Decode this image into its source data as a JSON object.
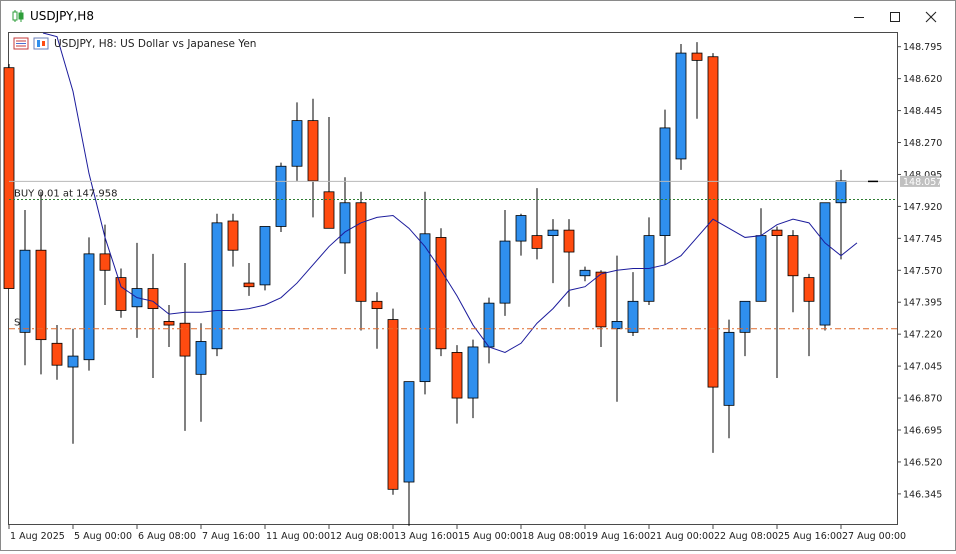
{
  "window": {
    "title": "USDJPY,H8"
  },
  "chart_header": {
    "text": "USDJPY, H8:  US Dollar vs Japanese Yen"
  },
  "trade_line": {
    "label": "BUY 0.01 at 147.958",
    "price": 147.958,
    "color": "#2e7d32"
  },
  "stop_line": {
    "label": "S",
    "price": 147.25,
    "color": "#e06a2c"
  },
  "current_price": {
    "label": "148.057",
    "price": 148.057
  },
  "colors": {
    "bull": "#2f8fee",
    "bear": "#ff4b10",
    "ma": "#1c1c9c",
    "grid": "#c8c8c8"
  },
  "chart_data": {
    "type": "candlestick",
    "symbol": "USDJPY",
    "timeframe": "H8",
    "ylim": [
      146.18,
      148.87
    ],
    "y_ticks": [
      "148.795",
      "148.620",
      "148.445",
      "148.270",
      "148.095",
      "147.920",
      "147.745",
      "147.570",
      "147.395",
      "147.220",
      "147.045",
      "146.870",
      "146.695",
      "146.520",
      "146.345"
    ],
    "x_ticks": [
      "1 Aug 2025",
      "5 Aug 00:00",
      "6 Aug 08:00",
      "7 Aug 16:00",
      "11 Aug 00:00",
      "12 Aug 08:00",
      "13 Aug 16:00",
      "15 Aug 00:00",
      "18 Aug 08:00",
      "19 Aug 16:00",
      "21 Aug 00:00",
      "22 Aug 08:00",
      "25 Aug 16:00",
      "27 Aug 00:00"
    ],
    "candles": [
      {
        "o": 148.68,
        "h": 148.7,
        "l": 147.47,
        "c": 147.47
      },
      {
        "o": 147.23,
        "h": 147.9,
        "l": 147.05,
        "c": 147.68
      },
      {
        "o": 147.68,
        "h": 148.0,
        "l": 147.0,
        "c": 147.19
      },
      {
        "o": 147.17,
        "h": 147.27,
        "l": 146.97,
        "c": 147.05
      },
      {
        "o": 147.04,
        "h": 147.25,
        "l": 146.62,
        "c": 147.1
      },
      {
        "o": 147.08,
        "h": 147.75,
        "l": 147.02,
        "c": 147.66
      },
      {
        "o": 147.66,
        "h": 147.82,
        "l": 147.38,
        "c": 147.57
      },
      {
        "o": 147.53,
        "h": 147.58,
        "l": 147.31,
        "c": 147.35
      },
      {
        "o": 147.37,
        "h": 147.72,
        "l": 147.2,
        "c": 147.47
      },
      {
        "o": 147.47,
        "h": 147.66,
        "l": 146.98,
        "c": 147.36
      },
      {
        "o": 147.29,
        "h": 147.38,
        "l": 147.15,
        "c": 147.27
      },
      {
        "o": 147.28,
        "h": 147.61,
        "l": 146.69,
        "c": 147.1
      },
      {
        "o": 147.0,
        "h": 147.28,
        "l": 146.74,
        "c": 147.18
      },
      {
        "o": 147.14,
        "h": 147.88,
        "l": 147.1,
        "c": 147.83
      },
      {
        "o": 147.84,
        "h": 147.88,
        "l": 147.59,
        "c": 147.68
      },
      {
        "o": 147.5,
        "h": 147.61,
        "l": 147.43,
        "c": 147.48
      },
      {
        "o": 147.49,
        "h": 147.79,
        "l": 147.46,
        "c": 147.81
      },
      {
        "o": 147.81,
        "h": 148.16,
        "l": 147.78,
        "c": 148.14
      },
      {
        "o": 148.14,
        "h": 148.49,
        "l": 148.06,
        "c": 148.39
      },
      {
        "o": 148.39,
        "h": 148.51,
        "l": 147.86,
        "c": 148.06
      },
      {
        "o": 148.0,
        "h": 148.41,
        "l": 147.86,
        "c": 147.8
      },
      {
        "o": 147.72,
        "h": 148.08,
        "l": 147.55,
        "c": 147.94
      },
      {
        "o": 147.94,
        "h": 148.0,
        "l": 147.24,
        "c": 147.4
      },
      {
        "o": 147.4,
        "h": 147.45,
        "l": 147.14,
        "c": 147.36
      },
      {
        "o": 147.3,
        "h": 147.36,
        "l": 146.34,
        "c": 146.37
      },
      {
        "o": 146.41,
        "h": 146.96,
        "l": 146.17,
        "c": 146.96
      },
      {
        "o": 146.96,
        "h": 148.0,
        "l": 146.89,
        "c": 147.77
      },
      {
        "o": 147.75,
        "h": 147.8,
        "l": 147.1,
        "c": 147.14
      },
      {
        "o": 147.12,
        "h": 147.16,
        "l": 146.73,
        "c": 146.87
      },
      {
        "o": 146.87,
        "h": 147.19,
        "l": 146.76,
        "c": 147.15
      },
      {
        "o": 147.15,
        "h": 147.42,
        "l": 147.06,
        "c": 147.39
      },
      {
        "o": 147.39,
        "h": 147.9,
        "l": 147.32,
        "c": 147.73
      },
      {
        "o": 147.73,
        "h": 147.88,
        "l": 147.65,
        "c": 147.87
      },
      {
        "o": 147.76,
        "h": 148.02,
        "l": 147.63,
        "c": 147.69
      },
      {
        "o": 147.76,
        "h": 147.85,
        "l": 147.5,
        "c": 147.79
      },
      {
        "o": 147.79,
        "h": 147.85,
        "l": 147.37,
        "c": 147.67
      },
      {
        "o": 147.54,
        "h": 147.59,
        "l": 147.51,
        "c": 147.57
      },
      {
        "o": 147.56,
        "h": 147.57,
        "l": 147.15,
        "c": 147.26
      },
      {
        "o": 147.25,
        "h": 147.65,
        "l": 146.85,
        "c": 147.29
      },
      {
        "o": 147.23,
        "h": 147.56,
        "l": 147.21,
        "c": 147.4
      },
      {
        "o": 147.4,
        "h": 147.86,
        "l": 147.38,
        "c": 147.76
      },
      {
        "o": 147.76,
        "h": 148.45,
        "l": 147.6,
        "c": 148.35
      },
      {
        "o": 148.18,
        "h": 148.81,
        "l": 148.12,
        "c": 148.76
      },
      {
        "o": 148.76,
        "h": 148.82,
        "l": 148.4,
        "c": 148.72
      },
      {
        "o": 148.74,
        "h": 148.76,
        "l": 146.57,
        "c": 146.93
      },
      {
        "o": 146.83,
        "h": 147.3,
        "l": 146.65,
        "c": 147.23
      },
      {
        "o": 147.23,
        "h": 147.4,
        "l": 147.1,
        "c": 147.4
      },
      {
        "o": 147.4,
        "h": 147.91,
        "l": 147.4,
        "c": 147.76
      },
      {
        "o": 147.79,
        "h": 147.81,
        "l": 146.98,
        "c": 147.76
      },
      {
        "o": 147.76,
        "h": 147.79,
        "l": 147.34,
        "c": 147.54
      },
      {
        "o": 147.53,
        "h": 147.55,
        "l": 147.1,
        "c": 147.4
      },
      {
        "o": 147.27,
        "h": 147.94,
        "l": 147.24,
        "c": 147.94
      },
      {
        "o": 147.94,
        "h": 148.12,
        "l": 147.63,
        "c": 148.06
      }
    ],
    "moving_average": [
      null,
      null,
      148.95,
      148.85,
      148.55,
      148.1,
      147.75,
      147.48,
      147.42,
      147.4,
      147.33,
      147.34,
      147.34,
      147.35,
      147.35,
      147.36,
      147.38,
      147.42,
      147.5,
      147.6,
      147.7,
      147.78,
      147.83,
      147.86,
      147.87,
      147.8,
      147.7,
      147.57,
      147.43,
      147.27,
      147.15,
      147.12,
      147.17,
      147.28,
      147.36,
      147.46,
      147.48,
      147.55,
      147.57,
      147.58,
      147.58,
      147.6,
      147.65,
      147.75,
      147.85,
      147.8,
      147.75,
      147.76,
      147.82,
      147.85,
      147.83,
      147.72,
      147.65,
      147.72
    ]
  }
}
